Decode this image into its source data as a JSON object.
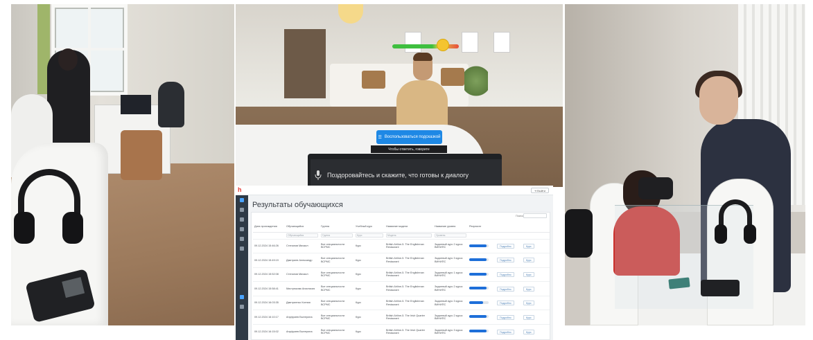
{
  "vr_scene": {
    "hint_button_label": "Воспользоваться подсказкой",
    "hint_caption": "Чтобы ответить, говорите",
    "prompt_text": "Поздоровайтесь и скажите, что готовы к диалогу"
  },
  "results": {
    "exit_label": "Выйти",
    "page_title": "Результаты обучающихся",
    "search_label": "Поиск",
    "columns": [
      "Дата прохождения",
      "Обучающийся",
      "Группа",
      "Учебный курс",
      "Название модели",
      "Название уровня",
      "Результат",
      "",
      ""
    ],
    "filters": [
      "",
      "Обучающийся",
      "Группа",
      "Курс",
      "Модель",
      "Уровень",
      "",
      "",
      ""
    ],
    "rows": [
      {
        "date": "09.12.2024 15:46:26",
        "student": "Степанов Михаил",
        "group": "Все специальности ВСРМС",
        "course": "Курс",
        "model": "British Airline-5. The Englishman Restaurant",
        "level": "Заданный курс 2 курса ВИНИПС",
        "progress": 0.9,
        "details": "Подробно",
        "open": "Курс"
      },
      {
        "date": "09.12.2024 15:49:19",
        "student": "Дмитриев Александр",
        "group": "Все специальности ВСРМС",
        "course": "Курс",
        "model": "British Airline-5. The Englishman Restaurant",
        "level": "Заданный курс 3 курса ВИНИПС",
        "progress": 0.9,
        "details": "Подробно",
        "open": "Курс"
      },
      {
        "date": "09.12.2024 15:52:08",
        "student": "Степанов Михаил",
        "group": "Все специальности ВСРМС",
        "course": "Курс",
        "model": "British Airline-5. The Englishman Restaurant",
        "level": "Заданный курс 1 курса ВИНИПС",
        "progress": 0.9,
        "details": "Подробно",
        "open": "Курс"
      },
      {
        "date": "09.12.2024 15:58:41",
        "student": "Мистрюкова Анастасия",
        "group": "Все специальности ВСРМС",
        "course": "Курс",
        "model": "British Airline-5. The Englishman Restaurant",
        "level": "Заданный курс 2 курса ВИНИПС",
        "progress": 0.9,
        "details": "Подробно",
        "open": "Курс"
      },
      {
        "date": "09.12.2024 16:03:35",
        "student": "Дмитриенко Ксения",
        "group": "Все специальности ВСРМС",
        "course": "Курс",
        "model": "British Airline-5. The Englishman Restaurant",
        "level": "Заданный курс 3 курса ВИНИПС",
        "progress": 0.7,
        "details": "Подробно",
        "open": "Курс"
      },
      {
        "date": "09.12.2024 16:10:17",
        "student": "Ануфриев Екатерина",
        "group": "Все специальности ВСРМС",
        "course": "Курс",
        "model": "British Airline-5. The Irish Quarter Restaurant",
        "level": "Заданный курс 2 курса ВИНИПС",
        "progress": 0.9,
        "details": "Подробно",
        "open": "Курс"
      },
      {
        "date": "09.12.2024 16:15:02",
        "student": "Ануфриев Екатерина",
        "group": "Все специальности ВСРМС",
        "course": "Курс",
        "model": "British Airline-5. The Irish Quarter Restaurant",
        "level": "Заданный курс 3 курса ВИНИПС",
        "progress": 0.9,
        "details": "Подробно",
        "open": "Курс"
      }
    ],
    "progress_color": "#1e6fd9"
  }
}
